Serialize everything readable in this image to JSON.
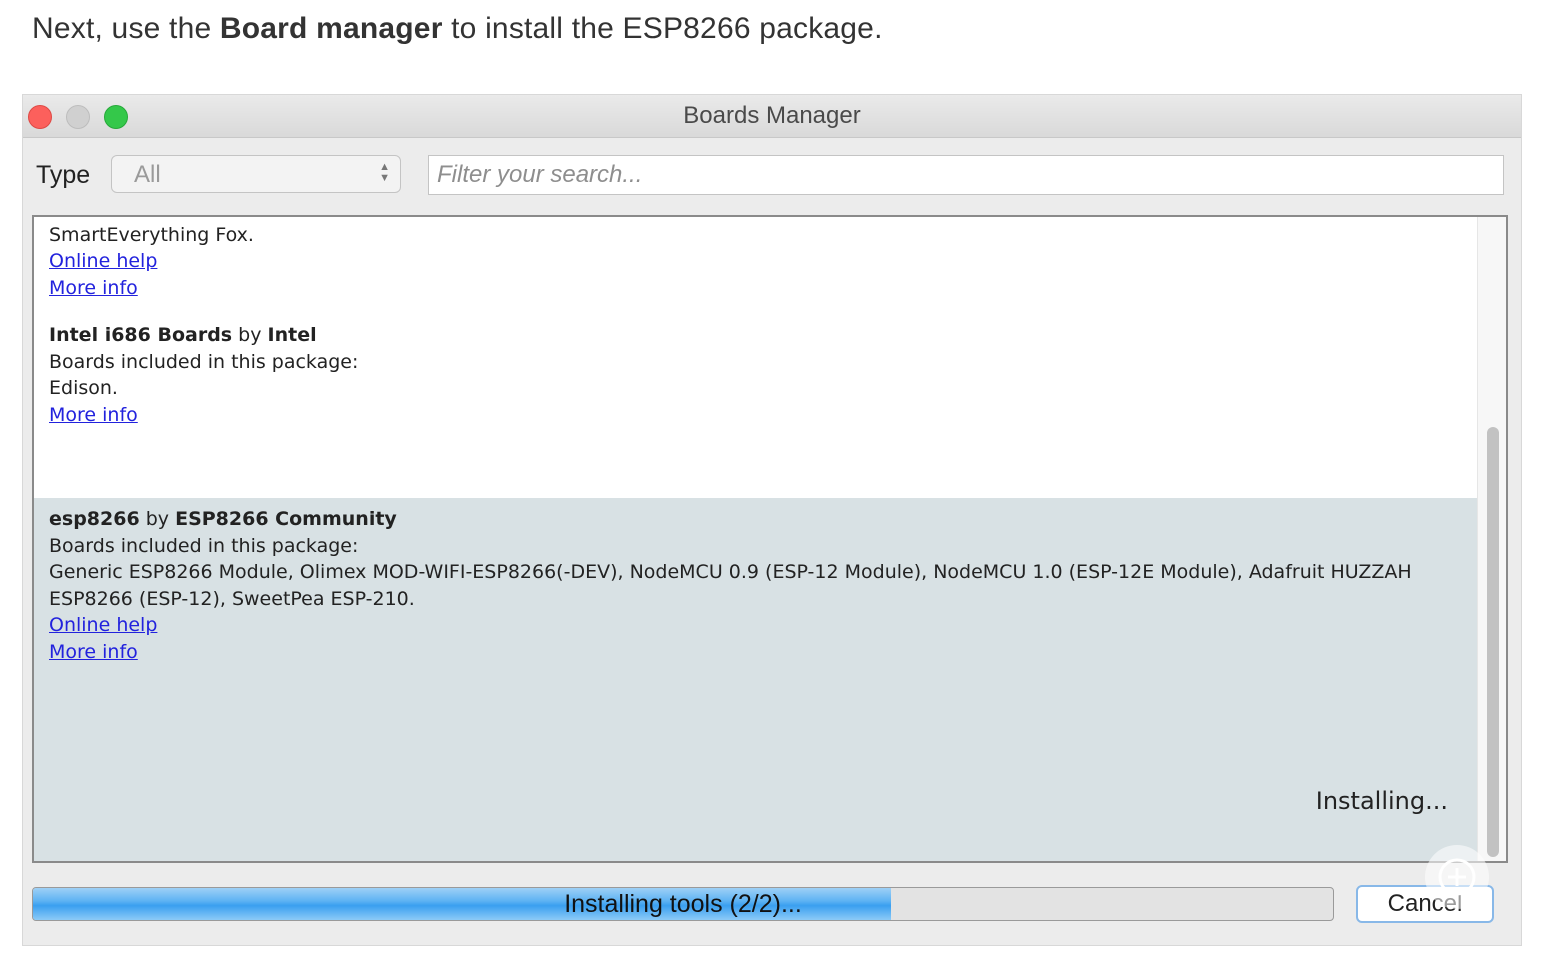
{
  "intro": {
    "prefix": "Next, use the ",
    "bold": "Board manager",
    "suffix": " to install the ESP8266 package."
  },
  "window": {
    "title": "Boards Manager"
  },
  "filter": {
    "type_label": "Type",
    "type_value": "All",
    "search_placeholder": "Filter your search..."
  },
  "entries": [
    {
      "text": "SmartEverything Fox.",
      "online_help": "Online help",
      "more_info": "More info"
    },
    {
      "name": "Intel i686 Boards",
      "by": "by",
      "author": "Intel",
      "included": "Boards included in this package:",
      "boards": "Edison.",
      "more_info": "More info"
    },
    {
      "name": "esp8266",
      "by": "by",
      "author": "ESP8266 Community",
      "included": "Boards included in this package:",
      "boards_line1": "Generic ESP8266 Module, Olimex MOD-WIFI-ESP8266(-DEV), NodeMCU 0.9 (ESP-12 Module), NodeMCU 1.0 (ESP-12E Module), Adafruit HUZZAH",
      "boards_line2": "ESP8266 (ESP-12), SweetPea ESP-210.",
      "online_help": "Online help",
      "more_info": "More info",
      "status": "Installing..."
    }
  ],
  "progress": {
    "label": "Installing tools (2/2)...",
    "fraction": 0.66
  },
  "buttons": {
    "cancel": "Cancel"
  },
  "colors": {
    "selected_row": "#d8e1e4",
    "link": "#2222dd",
    "progress_fill": "#5fb3f3"
  }
}
